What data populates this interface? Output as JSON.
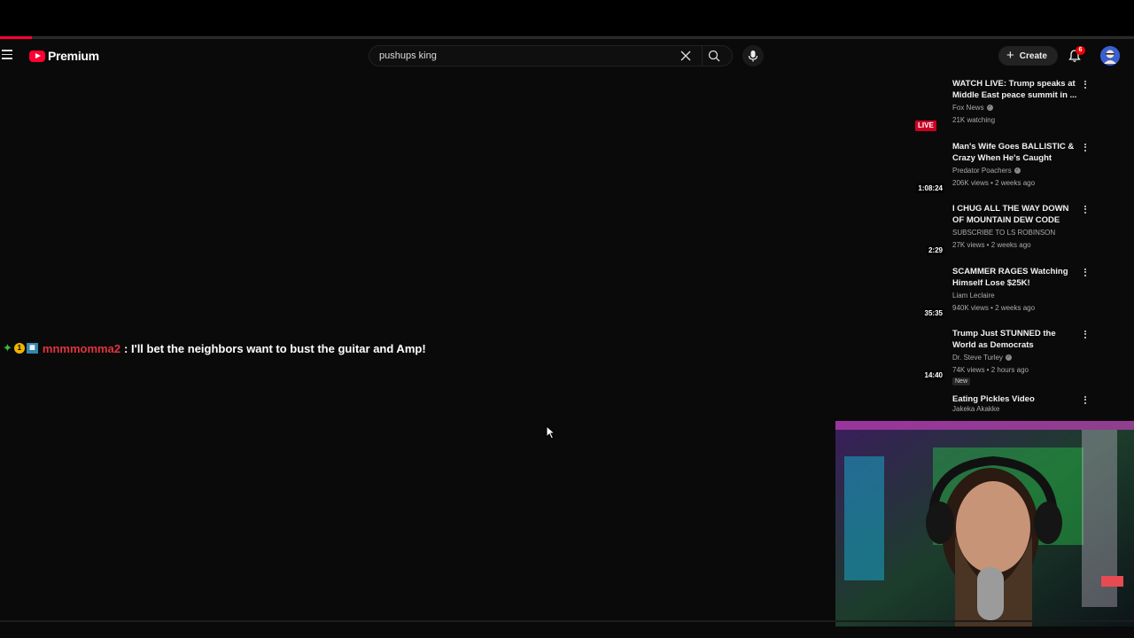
{
  "player": {
    "progress_fraction": 0.028
  },
  "header": {
    "logo_label": "Premium",
    "search_query": "pushups king",
    "create_label": "Create",
    "notification_count": "6"
  },
  "chat": {
    "username": "mnmmomma2",
    "message": ": I'll bet the neighbors want to bust the guitar and Amp!"
  },
  "sidebar": {
    "videos": [
      {
        "title": "WATCH LIVE: Trump speaks at Middle East peace summit in ...",
        "channel": "Fox News",
        "verified": true,
        "meta": "21K watching",
        "badge": "LIVE"
      },
      {
        "title": "Man's Wife Goes BALLISTIC & Crazy When He's Caught (Lake...",
        "channel": "Predator Poachers",
        "verified": true,
        "meta": "206K views • 2 weeks ago",
        "duration": "1:08:24"
      },
      {
        "title": "I CHUG ALL THE WAY DOWN OF MOUNTAIN DEW CODE RED ...",
        "channel": "SUBSCRIBE TO LS ROBINSON",
        "verified": false,
        "meta": "27K views • 2 weeks ago",
        "duration": "2:29"
      },
      {
        "title": "SCAMMER RAGES Watching Himself Lose $25K!",
        "channel": "Liam Leclaire",
        "verified": false,
        "meta": "940K views • 2 weeks ago",
        "duration": "35:35"
      },
      {
        "title": "Trump Just STUNNED the World as Democrats IMPLODE!!!",
        "channel": "Dr. Steve Turley",
        "verified": true,
        "meta": "74K views • 2 hours ago",
        "duration": "14:40",
        "tag": "New"
      },
      {
        "title": "Eating Pickles Video",
        "channel": "Jakeka Akakke",
        "verified": false
      }
    ]
  },
  "colors": {
    "accent": "#ff0033",
    "background": "#0a0a0a",
    "username": "#e0343f"
  }
}
